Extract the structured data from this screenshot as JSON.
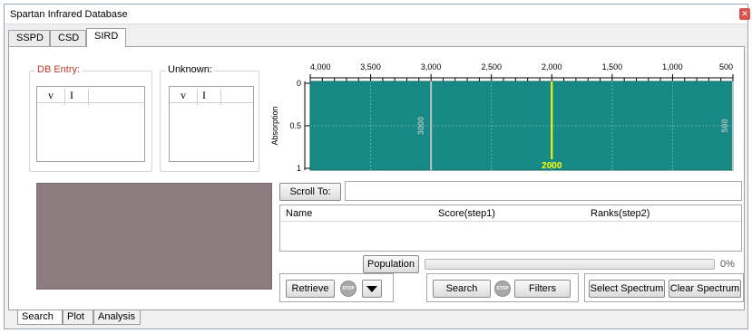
{
  "window": {
    "title": "Spartan Infrared Database"
  },
  "top_tabs": [
    "SSPD",
    "CSD",
    "SIRD"
  ],
  "db_entry": {
    "label": "DB Entry:",
    "columns": [
      "v",
      "I"
    ]
  },
  "unknown": {
    "label": "Unknown:",
    "columns": [
      "v",
      "I"
    ]
  },
  "spectrum": {
    "x_ticks": [
      "4,000",
      "3,500",
      "3,000",
      "2,500",
      "2,000",
      "1,500",
      "1,000",
      "500"
    ],
    "y_ticks": [
      "0",
      "0.5",
      "1"
    ],
    "y_label": "Absorption",
    "markers": [
      "3000",
      "2000",
      "500"
    ],
    "background_color": "#178a86",
    "highlight_color": "#ffff00"
  },
  "scroll": {
    "button": "Scroll To:",
    "value": ""
  },
  "results": {
    "columns": [
      "Name",
      "Score(step1)",
      "Ranks(step2)"
    ]
  },
  "population": {
    "button": "Population",
    "percent": "0%",
    "progress": 0
  },
  "buttons": {
    "retrieve": "Retrieve",
    "stop": "STOP",
    "search": "Search",
    "filters": "Filters",
    "select_spectrum": "Select Spectrum",
    "clear_spectrum": "Clear Spectrum"
  },
  "bottom_tabs": [
    "Search",
    "Plot",
    "Analysis"
  ]
}
